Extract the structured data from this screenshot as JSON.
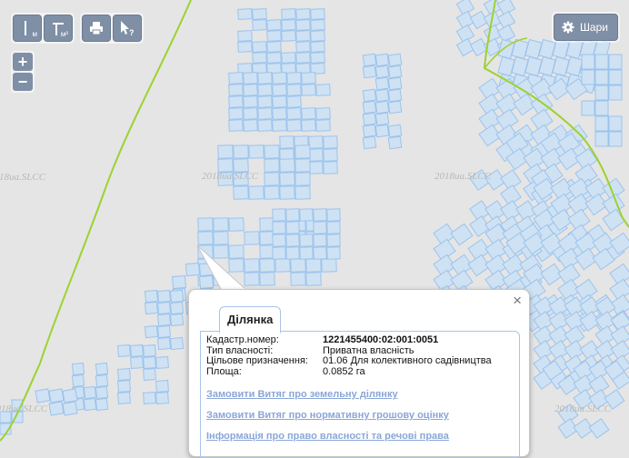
{
  "watermark": "2018иа.SLCC",
  "toolbar": {
    "ruler_unit": "м",
    "area_unit": "м²"
  },
  "zoom": {
    "plus": "+",
    "minus": "−"
  },
  "layers_button": {
    "label": "Шари"
  },
  "popup": {
    "close": "×",
    "tab_title": "Ділянка",
    "fields": [
      {
        "label": "Кадастр.номер:",
        "value": "1221455400:02:001:0051"
      },
      {
        "label": "Тип власності:",
        "value": "Приватна власність"
      },
      {
        "label": "Цільове призначення:",
        "value": "01.06 Для колективного садівництва"
      },
      {
        "label": "Площа:",
        "value": "0.0852 га"
      }
    ],
    "links": [
      "Замовити Витяг про земельну ділянку",
      "Замовити Витяг про нормативну грошову оцінку",
      "Інформація про право власності та речові права"
    ]
  },
  "colors": {
    "background": "#e5e5e5",
    "parcel_fill": "#cfe2f3",
    "parcel_stroke": "#9cc3ec",
    "boundary": "#9cd22f",
    "button": "#7f8fa6",
    "link": "#8aa6d8"
  }
}
